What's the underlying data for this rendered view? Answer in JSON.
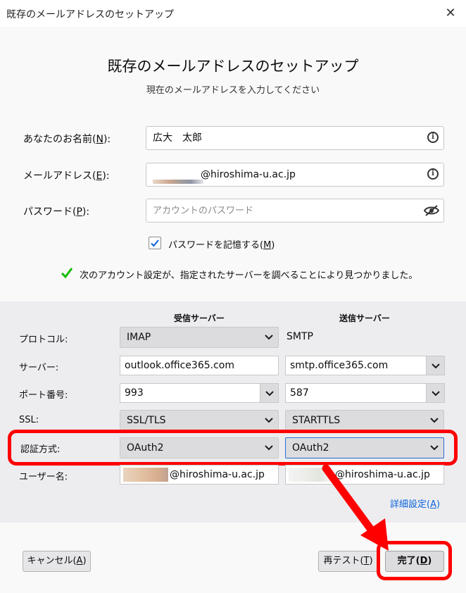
{
  "window": {
    "title": "既存のメールアドレスのセットアップ"
  },
  "header": {
    "title": "既存のメールアドレスのセットアップ",
    "subtitle": "現在のメールアドレスを入力してください"
  },
  "form": {
    "name_label": "あなたのお名前(",
    "name_key": "N",
    "name_suffix": "):",
    "name_value": "広大　太郎",
    "email_label": "メールアドレス(",
    "email_key": "E",
    "email_suffix": "):",
    "email_domain": "@hiroshima-u.ac.jp",
    "password_label": "パスワード(",
    "password_key": "P",
    "password_suffix": "):",
    "password_placeholder": "アカウントのパスワード",
    "remember_label": "パスワードを記憶する(",
    "remember_key": "M",
    "remember_suffix": ")",
    "remember_checked": true
  },
  "status": {
    "message": "次のアカウント設定が、指定されたサーバーを調べることにより見つかりました。"
  },
  "servers": {
    "incoming_header": "受信サーバー",
    "outgoing_header": "送信サーバー",
    "rows": {
      "protocol": {
        "label": "プロトコル:",
        "incoming": "IMAP",
        "outgoing": "SMTP"
      },
      "server": {
        "label": "サーバー:",
        "incoming": "outlook.office365.com",
        "outgoing": "smtp.office365.com"
      },
      "port": {
        "label": "ポート番号:",
        "incoming": "993",
        "outgoing": "587"
      },
      "ssl": {
        "label": "SSL:",
        "incoming": "SSL/TLS",
        "outgoing": "STARTTLS"
      },
      "auth": {
        "label": "認証方式:",
        "incoming": "OAuth2",
        "outgoing": "OAuth2"
      },
      "username": {
        "label": "ユーザー名:",
        "incoming_domain": "@hiroshima-u.ac.jp",
        "outgoing_domain": "@hiroshima-u.ac.jp"
      }
    },
    "advanced_link": "詳細設定(",
    "advanced_key": "A",
    "advanced_suffix": ")"
  },
  "footer": {
    "cancel_label": "キャンセル(",
    "cancel_key": "A",
    "cancel_suffix": ")",
    "retest_label": "再テスト(",
    "retest_key": "T",
    "retest_suffix": ")",
    "done_label": "完了(",
    "done_key": "D",
    "done_suffix": ")"
  },
  "colors": {
    "highlight": "#ff0000",
    "link": "#0a63d8",
    "check": "#12bc00",
    "focus": "#2b6dd8"
  }
}
